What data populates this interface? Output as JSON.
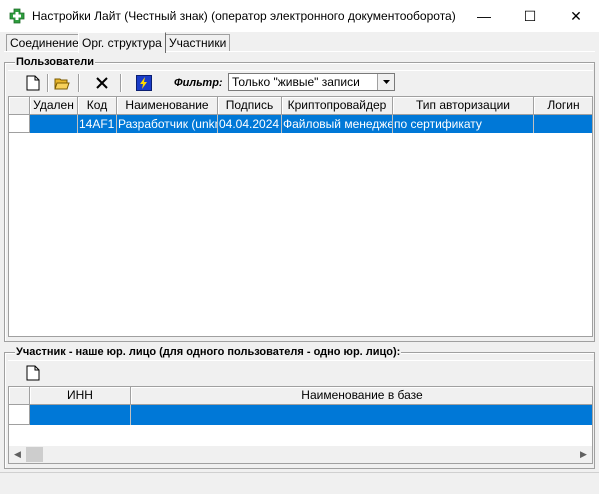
{
  "window": {
    "title": "Настройки Лайт (Честный знак) (оператор электронного документооборота)",
    "minimize_glyph": "—",
    "maximize_glyph": "☐",
    "close_glyph": "✕"
  },
  "tabs": [
    {
      "label": "Соединение",
      "active": false
    },
    {
      "label": "Орг. структура",
      "active": true
    },
    {
      "label": "Участники",
      "active": false
    }
  ],
  "users_group": {
    "label": "Пользователи",
    "toolbar": {
      "buttons": [
        "new-document-icon",
        "open-folder-icon",
        "delete-icon",
        "lightning-icon"
      ],
      "filter_label": "Фильтр:",
      "filter_value": "Только \"живые\" записи"
    },
    "columns": [
      "Удален",
      "Код",
      "Наименование",
      "Подпись",
      "Криптопровайдер",
      "Тип авторизации",
      "Логин"
    ],
    "rows": [
      [
        "",
        "14AF1",
        "Разработчик (unknown)",
        "04.04.2024",
        "Файловый менеджер",
        "по сертификату",
        ""
      ]
    ]
  },
  "participant_group": {
    "label": "Участник - наше юр. лицо (для одного пользователя - одно юр. лицо):",
    "toolbar": {
      "buttons": [
        "new-document-icon"
      ]
    },
    "columns": [
      "ИНН",
      "Наименование в базе"
    ],
    "rows": [
      [
        "",
        ""
      ]
    ]
  },
  "colors": {
    "selection": "#0078d7",
    "app_icon": "#2e9e3e"
  }
}
